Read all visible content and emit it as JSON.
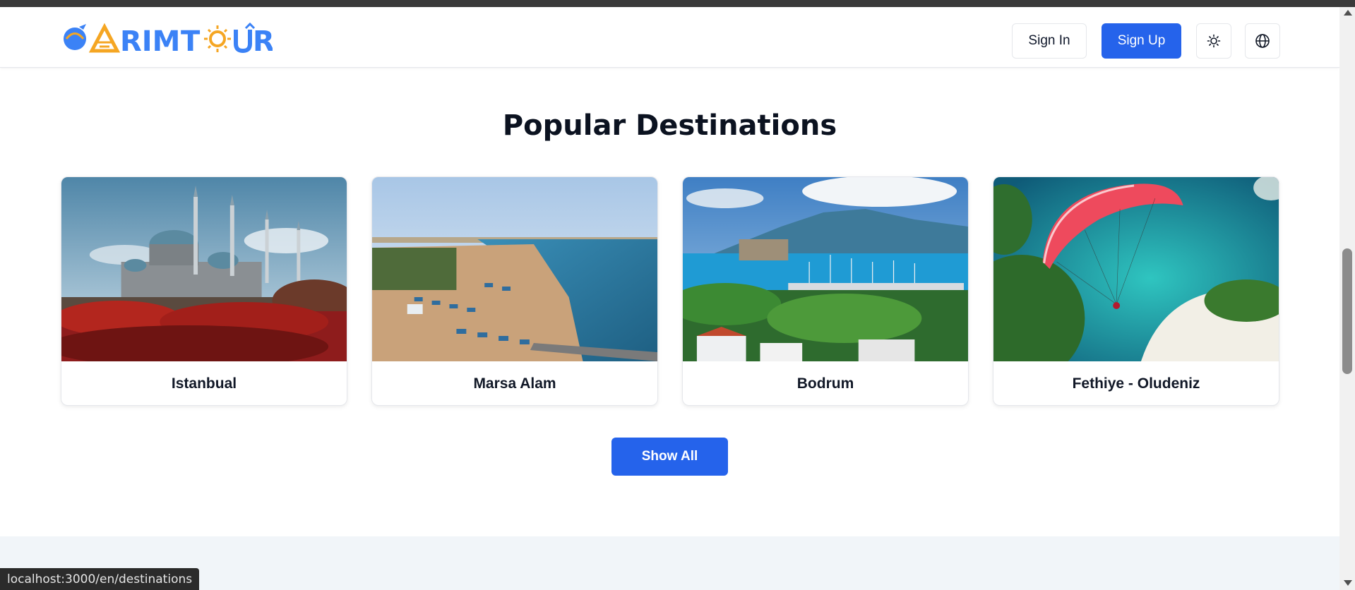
{
  "header": {
    "logo_text": "KARIM TOUR",
    "sign_in_label": "Sign In",
    "sign_up_label": "Sign Up",
    "theme_icon": "sun-icon",
    "language_icon": "globe-icon"
  },
  "section": {
    "title": "Popular Destinations",
    "destinations": [
      {
        "name": "Istanbual",
        "image": "mosque-skyline"
      },
      {
        "name": "Marsa Alam",
        "image": "beach-coast"
      },
      {
        "name": "Bodrum",
        "image": "harbor-marina"
      },
      {
        "name": "Fethiye - Oludeniz",
        "image": "paraglider-lagoon"
      }
    ],
    "show_all_label": "Show All"
  },
  "status_url": "localhost:3000/en/destinations",
  "colors": {
    "primary": "#2563eb",
    "logo_blue": "#3b82f6",
    "logo_yellow": "#f5a623",
    "footer_bg": "#f1f5f9"
  }
}
